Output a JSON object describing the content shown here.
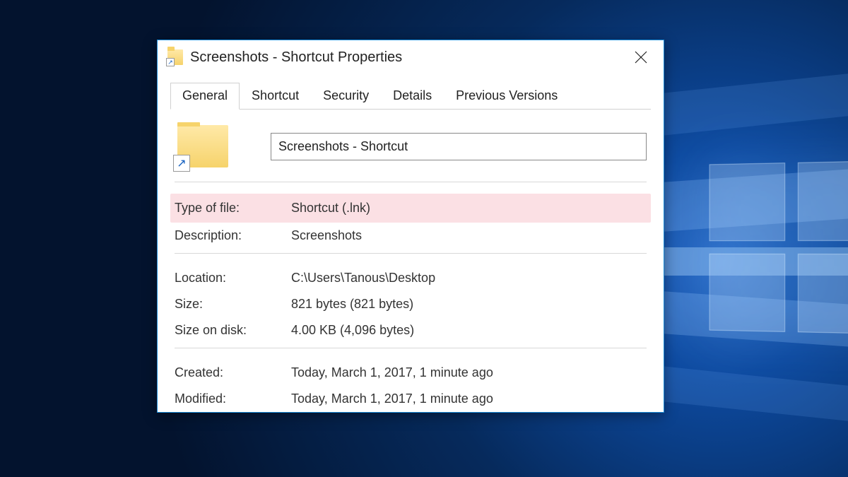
{
  "window": {
    "title": "Screenshots - Shortcut Properties"
  },
  "tabs": {
    "general": "General",
    "shortcut": "Shortcut",
    "security": "Security",
    "details": "Details",
    "previous": "Previous Versions"
  },
  "fields": {
    "name": "Screenshots - Shortcut",
    "type_label": "Type of file:",
    "type_value": "Shortcut (.lnk)",
    "desc_label": "Description:",
    "desc_value": "Screenshots",
    "location_label": "Location:",
    "location_value": "C:\\Users\\Tanous\\Desktop",
    "size_label": "Size:",
    "size_value": "821 bytes (821 bytes)",
    "sizedisk_label": "Size on disk:",
    "sizedisk_value": "4.00 KB (4,096 bytes)",
    "created_label": "Created:",
    "created_value": "Today, March 1, 2017, 1 minute ago",
    "modified_label": "Modified:",
    "modified_value": "Today, March 1, 2017, 1 minute ago"
  }
}
